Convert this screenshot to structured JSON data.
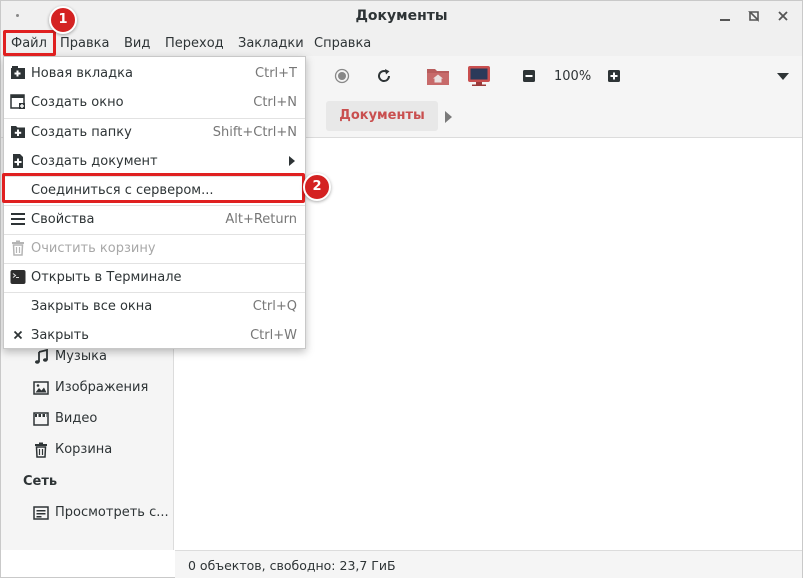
{
  "window": {
    "title": "Документы"
  },
  "menubar": {
    "items": [
      "Файл",
      "Правка",
      "Вид",
      "Переход",
      "Закладки",
      "Справка"
    ]
  },
  "toolbar": {
    "zoom": "100%"
  },
  "pathbar": {
    "current": "Документы"
  },
  "sidebar": {
    "items": [
      {
        "label": "Музыка",
        "icon": "music-icon"
      },
      {
        "label": "Изображения",
        "icon": "image-icon"
      },
      {
        "label": "Видео",
        "icon": "video-icon"
      },
      {
        "label": "Корзина",
        "icon": "trash-icon"
      }
    ],
    "network_heading": "Сеть",
    "network_items": [
      {
        "label": "Просмотреть с...",
        "icon": "network-icon"
      }
    ]
  },
  "status": {
    "text": "0 объектов, свободно: 23,7 ГиБ"
  },
  "file_menu": {
    "items": [
      {
        "label": "Новая вкладка",
        "shortcut": "Ctrl+T",
        "icon": "new-tab-icon"
      },
      {
        "label": "Создать окно",
        "shortcut": "Ctrl+N",
        "icon": "new-window-icon"
      },
      {
        "label": "Создать папку",
        "shortcut": "Shift+Ctrl+N",
        "icon": "new-folder-icon"
      },
      {
        "label": "Создать документ",
        "shortcut": "",
        "icon": "new-document-icon"
      },
      {
        "label": "Соединиться с сервером...",
        "shortcut": "",
        "icon": ""
      },
      {
        "label": "Свойства",
        "shortcut": "Alt+Return",
        "icon": "properties-icon"
      },
      {
        "label": "Очистить корзину",
        "shortcut": "",
        "icon": "trash-icon"
      },
      {
        "label": "Открыть в Терминале",
        "shortcut": "",
        "icon": "terminal-icon"
      },
      {
        "label": "Закрыть все окна",
        "shortcut": "Ctrl+Q",
        "icon": ""
      },
      {
        "label": "Закрыть",
        "shortcut": "Ctrl+W",
        "icon": "close-icon"
      }
    ]
  },
  "annotations": {
    "step1": "1",
    "step2": "2"
  },
  "colors": {
    "accent": "#c94f4f",
    "annotation": "#e02020"
  }
}
